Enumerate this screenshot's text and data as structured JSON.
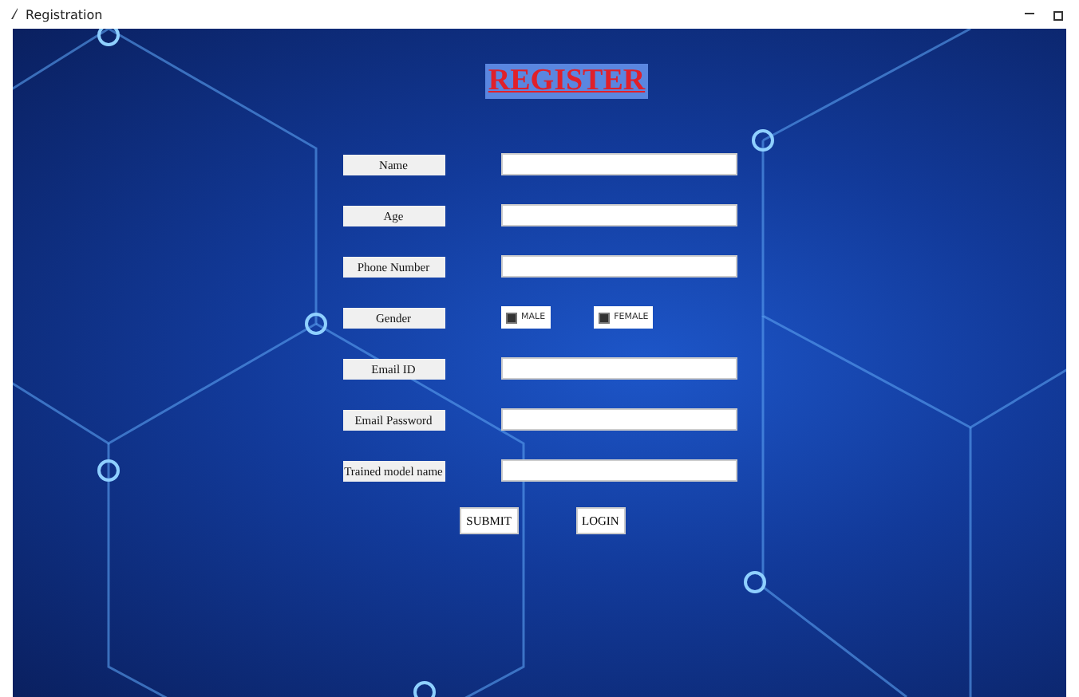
{
  "window": {
    "title": "Registration"
  },
  "heading": "REGISTER",
  "rows": [
    {
      "kind": "entry",
      "label": "Name"
    },
    {
      "kind": "entry",
      "label": "Age"
    },
    {
      "kind": "entry",
      "label": "Phone Number"
    },
    {
      "kind": "radio",
      "label": "Gender",
      "options": [
        {
          "label": "MALE",
          "selected": true
        },
        {
          "label": "FEMALE",
          "selected": true
        }
      ]
    },
    {
      "kind": "entry",
      "label": "Email ID"
    },
    {
      "kind": "entry",
      "label": "Email Password"
    },
    {
      "kind": "entry",
      "label": "Trained model name"
    }
  ],
  "buttons": [
    "SUBMIT",
    "LOGIN"
  ]
}
